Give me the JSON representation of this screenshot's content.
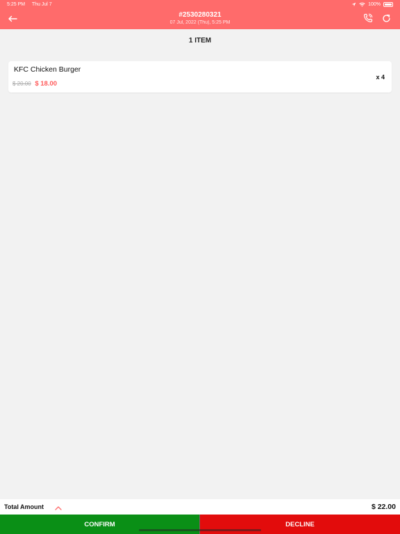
{
  "status_bar": {
    "time": "5:25 PM",
    "date": "Thu Jul 7",
    "battery": "100%"
  },
  "header": {
    "order_number": "#2530280321",
    "order_date": "07 Jul, 2022 (Thu), 5:25 PM"
  },
  "items_section": {
    "title": "1 ITEM"
  },
  "items": [
    {
      "name": "KFC Chicken Burger",
      "original_price": "$ 20.00",
      "price": "$ 18.00",
      "quantity": "x 4"
    }
  ],
  "total": {
    "label": "Total Amount",
    "value": "$ 22.00"
  },
  "actions": {
    "confirm_label": "CONFIRM",
    "decline_label": "DECLINE"
  },
  "colors": {
    "header": "#ff6b6b",
    "confirm": "#0a8f16",
    "decline": "#e20c0c",
    "price_accent": "#ff5a5a"
  }
}
